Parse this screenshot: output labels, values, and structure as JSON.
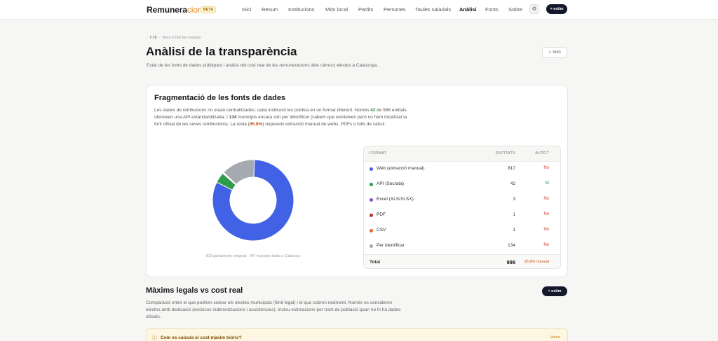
{
  "brand": {
    "name_a": "Remunera",
    "name_b": "cions",
    "badge": "BETA"
  },
  "nav": {
    "items": [
      {
        "label": "Inici"
      },
      {
        "label": "Resum"
      },
      {
        "label": "Institucions"
      },
      {
        "label": "Món local"
      },
      {
        "label": "Partits"
      },
      {
        "label": "Persones"
      },
      {
        "label": "Taules salarials"
      },
      {
        "label": "Anàlisi",
        "active": true
      },
      {
        "label": "Fonts"
      },
      {
        "label": "Sobre"
      }
    ],
    "gear_icon": "gear-icon",
    "estim_label": "+ estim"
  },
  "header": {
    "crumb_prev": "‹",
    "crumb_count": "7 / 9",
    "crumb_next": "›",
    "crumb_hint": "Roca el títol per navegar",
    "title": "Anàlisi de la transparència",
    "subtitle": "Estat de les fonts de dades públiques i anàlisi del cost real de les remuneracions dels càrrecs electes a Catalunya.",
    "home_icon": "home-icon",
    "home_label": "Inici"
  },
  "fragmentation": {
    "title": "Fragmentació de les fonts de dades",
    "text": {
      "p1": "Les dades de retribucions no estan centralitzades: cada institució les publica en un format diferent. Només ",
      "n1": "42",
      "p2": " de 998 entitats ofereixen una API estandarditzada. I ",
      "n2": "134",
      "p3": " municipis encara són ",
      "em": "per identificar",
      "p4": " (sabem que existeixen però no hem localitzat la font oficial de les seves retribucions). La resta (",
      "n3": "95.8%",
      "p5": ") requereix extracció manual de webs, PDFs o fulls de càlcul."
    },
    "caption": "813 ajuntaments integrats · 947 municipis totals a Catalunya",
    "table": {
      "headers": {
        "format": "FORMAT",
        "count": "ENTITATS",
        "auto": "AUTO?"
      },
      "rows": [
        {
          "label": "Web (extracció manual)",
          "count": 817,
          "count_text": "817",
          "auto": "No",
          "color": "#4262e6"
        },
        {
          "label": "API (Socrata)",
          "count": 42,
          "count_text": "42",
          "auto": "Sí",
          "color": "#2e9d4b"
        },
        {
          "label": "Excel (XLS/XLSX)",
          "count": 3,
          "count_text": "3",
          "auto": "No",
          "color": "#8b4fd6"
        },
        {
          "label": "PDF",
          "count": 1,
          "count_text": "1",
          "auto": "No",
          "color": "#b8321f"
        },
        {
          "label": "CSV",
          "count": 1,
          "count_text": "1",
          "auto": "No",
          "color": "#e06a2a"
        },
        {
          "label": "Per identificar",
          "count": 134,
          "count_text": "134",
          "auto": "No",
          "color": "#a5a9b0"
        }
      ],
      "total_label": "Total",
      "total": "998",
      "total_pct": "95.8% manual"
    }
  },
  "chart_data": {
    "type": "pie",
    "categories": [
      "Web (extracció manual)",
      "API (Socrata)",
      "Excel (XLS/XLSX)",
      "PDF",
      "CSV",
      "Per identificar"
    ],
    "values": [
      817,
      42,
      3,
      1,
      1,
      134
    ],
    "colors": [
      "#4262e6",
      "#2e9d4b",
      "#8b4fd6",
      "#b8321f",
      "#e06a2a",
      "#a5a9b0"
    ],
    "title": "",
    "legend": "table-right"
  },
  "legal": {
    "title": "Màxims legals vs cost real",
    "estim_label": "+ estim",
    "text": "Comparació entre el que podrien cobrar els electes municipals (límit legal) i el que cobren realment. Només es consideren electes amb dedicació (exclosos indemnitzacions i assistències). Inclou estimacions per tram de població quan no hi ha dades oficials.",
    "faq_icon": "help-circle-icon",
    "faq_question": "Com es calcula el cost màxim teòric?",
    "faq_action": "Veure"
  }
}
